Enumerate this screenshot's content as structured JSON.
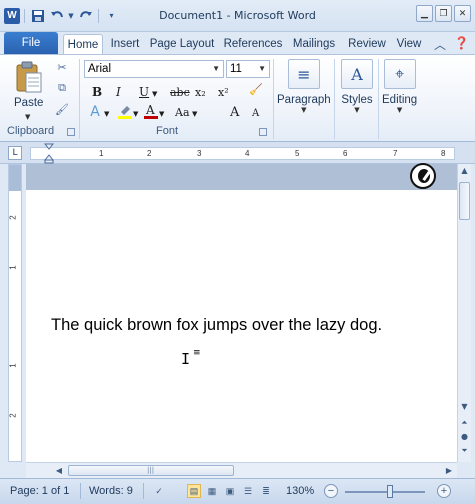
{
  "window": {
    "title": "Document1  -  Microsoft Word",
    "app_logo": "W"
  },
  "quick_access": {
    "icons": [
      "word-logo",
      "save-icon",
      "undo-icon",
      "redo-icon",
      "customize-icon"
    ]
  },
  "tabs": {
    "file": "File",
    "items": [
      "Home",
      "Insert",
      "Page Layout",
      "References",
      "Mailings",
      "Review",
      "View"
    ],
    "active": "Home"
  },
  "ribbon": {
    "clipboard": {
      "paste_label": "Paste",
      "group_label": "Clipboard"
    },
    "font": {
      "font_name": "Arial",
      "font_size": "11",
      "bold": "B",
      "italic": "I",
      "underline": "U",
      "strikethrough": "abc",
      "subscript": "x₂",
      "superscript": "x²",
      "grow_font": "A",
      "shrink_font": "A",
      "change_case": "Aa",
      "group_label": "Font"
    },
    "paragraph_label": "Paragraph",
    "styles_label": "Styles",
    "editing_label": "Editing",
    "colors": {
      "highlight": "#ffff00",
      "font_color": "#c00000"
    }
  },
  "ruler": {
    "marks": [
      "1",
      "2",
      "3",
      "4",
      "5",
      "6",
      "7",
      "8"
    ],
    "vertical_marks": [
      "2",
      "1",
      "1",
      "2"
    ]
  },
  "document": {
    "text": "The quick brown fox jumps over the lazy dog."
  },
  "status": {
    "page": "Page: 1 of 1",
    "words": "Words: 9",
    "zoom": "130%",
    "zoom_minus": "−",
    "zoom_plus": "+"
  },
  "colors": {
    "accent": "#2a62b0",
    "ribbon_bg": "#dfe9f5"
  }
}
